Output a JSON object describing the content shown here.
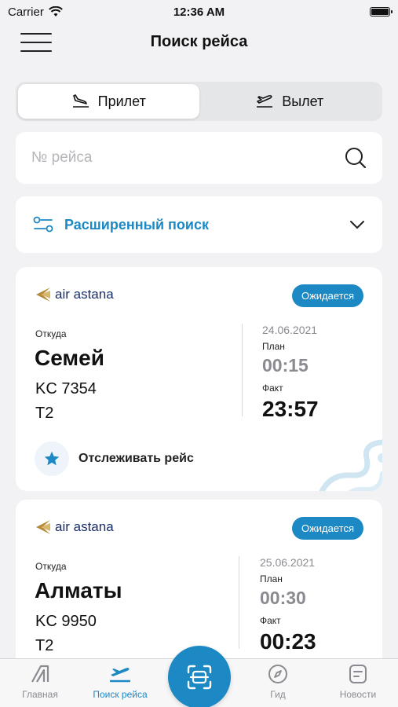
{
  "status_bar": {
    "carrier": "Carrier",
    "time": "12:36 AM"
  },
  "nav": {
    "title": "Поиск рейса"
  },
  "segment": {
    "arrival_label": "Прилет",
    "departure_label": "Вылет",
    "selected": "arrival"
  },
  "search": {
    "placeholder": "№ рейса",
    "value": ""
  },
  "advanced_search": {
    "label": "Расширенный поиск"
  },
  "flights": [
    {
      "airline": "air astana",
      "status": "Ожидается",
      "from_label": "Откуда",
      "city": "Семей",
      "flight_number": "KC 7354",
      "terminal": "T2",
      "date": "24.06.2021",
      "plan_label": "План",
      "plan_time": "00:15",
      "fact_label": "Факт",
      "fact_time": "23:57",
      "track_label": "Отслеживать рейс"
    },
    {
      "airline": "air astana",
      "status": "Ожидается",
      "from_label": "Откуда",
      "city": "Алматы",
      "flight_number": "KC 9950",
      "terminal": "T2",
      "date": "25.06.2021",
      "plan_label": "План",
      "plan_time": "00:30",
      "fact_label": "Факт",
      "fact_time": "00:23"
    }
  ],
  "tab_bar": {
    "items": [
      {
        "label": "Главная",
        "icon": "home-logo-icon"
      },
      {
        "label": "Поиск рейса",
        "icon": "airplane-icon"
      },
      {
        "label": "Гид",
        "icon": "compass-icon"
      },
      {
        "label": "Новости",
        "icon": "news-icon"
      }
    ],
    "active": "Поиск рейса",
    "scan_icon": "scan-icon"
  },
  "colors": {
    "accent": "#1c88c4",
    "airline": "#1a2f6a",
    "background": "#f2f2f4"
  }
}
